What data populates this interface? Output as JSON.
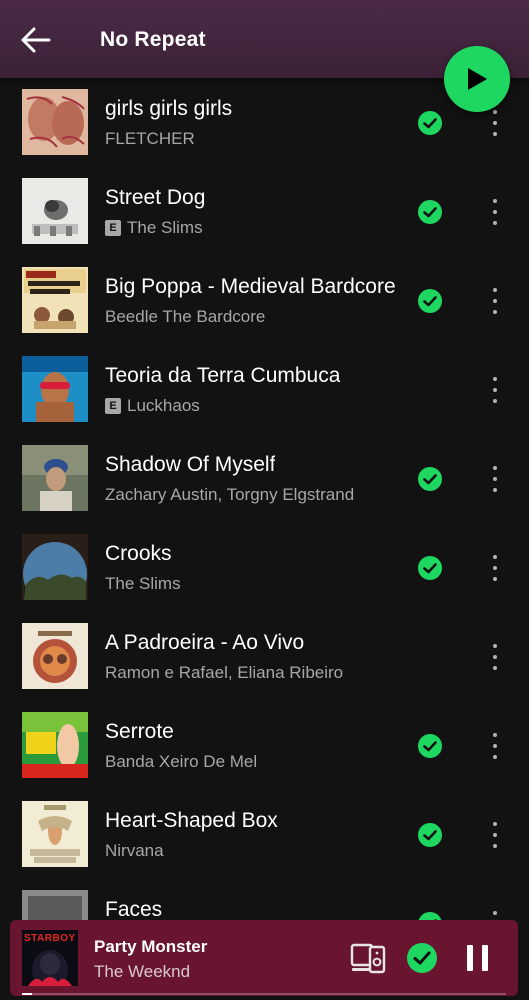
{
  "header": {
    "title": "No Repeat",
    "back_icon": "arrow-left-icon",
    "play_icon": "play-icon"
  },
  "colors": {
    "accent": "#1ed760",
    "header_bg": "#3b2238",
    "mini_player_bg": "#6a1530",
    "text_secondary": "#a7a7a7"
  },
  "tracks": [
    {
      "title": "girls girls girls",
      "subtitle": "FLETCHER",
      "explicit": false,
      "downloaded": true
    },
    {
      "title": "Street Dog",
      "subtitle": "The Slims",
      "explicit": true,
      "downloaded": true
    },
    {
      "title": "Big Poppa - Medieval Bardcore",
      "subtitle": "Beedle The Bardcore",
      "explicit": false,
      "downloaded": true
    },
    {
      "title": "Teoria da Terra Cumbuca",
      "subtitle": "Luckhaos",
      "explicit": true,
      "downloaded": false
    },
    {
      "title": "Shadow Of Myself",
      "subtitle": "Zachary Austin, Torgny Elgstrand",
      "explicit": false,
      "downloaded": true
    },
    {
      "title": "Crooks",
      "subtitle": "The Slims",
      "explicit": false,
      "downloaded": true
    },
    {
      "title": "A Padroeira - Ao Vivo",
      "subtitle": "Ramon e Rafael, Eliana Ribeiro",
      "explicit": false,
      "downloaded": false
    },
    {
      "title": "Serrote",
      "subtitle": "Banda Xeiro De Mel",
      "explicit": false,
      "downloaded": true
    },
    {
      "title": "Heart-Shaped Box",
      "subtitle": "Nirvana",
      "explicit": false,
      "downloaded": true
    },
    {
      "title": "Faces",
      "subtitle": "",
      "explicit": false,
      "downloaded": true
    }
  ],
  "explicit_label": "E",
  "now_playing": {
    "title": "Party Monster",
    "artist": "The Weeknd",
    "cover_text": "STARBOY",
    "progress": 0.02,
    "device_icon": "connect-device-icon",
    "downloaded_icon": "check-circle-icon",
    "pause_icon": "pause-icon"
  }
}
